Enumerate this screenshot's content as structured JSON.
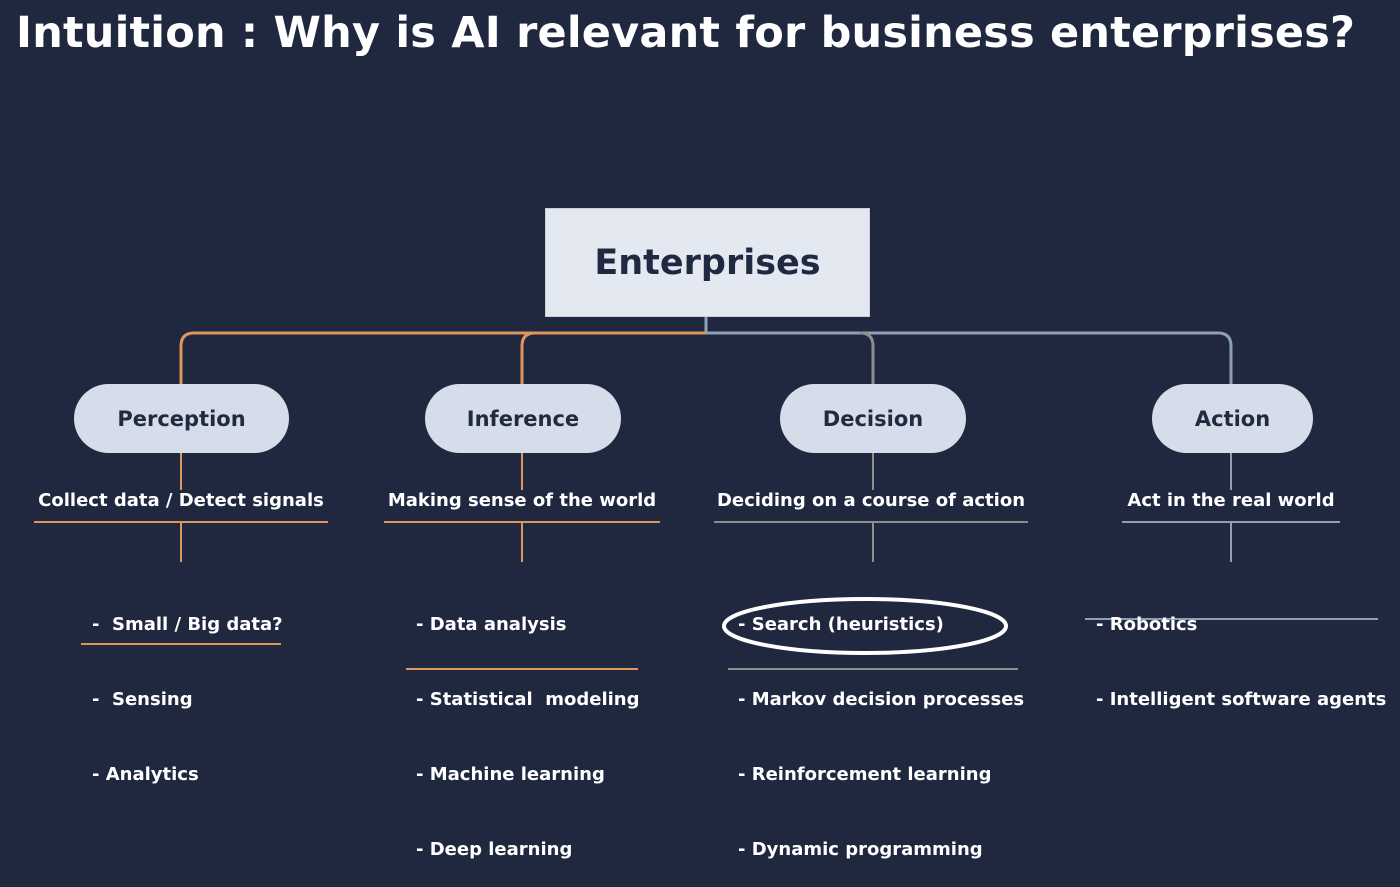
{
  "title": "Intuition : Why is AI relevant for business enterprises?",
  "root": {
    "label": "Enterprises"
  },
  "colors": {
    "background": "#202840",
    "orange": "#e0955a",
    "gray": "#8b8f87",
    "steel": "#8ea0b8",
    "pill": "#d5dcea",
    "root_box": "#e4e9f1",
    "highlight": "#ffffff"
  },
  "branches": [
    {
      "label": "Perception",
      "subtitle": "Collect data /  Detect signals",
      "items": [
        "-  Small / Big data?",
        "-  Sensing",
        "- Analytics"
      ]
    },
    {
      "label": "Inference",
      "subtitle": "Making sense of the world",
      "items": [
        "- Data analysis",
        "- Statistical  modeling",
        "- Machine learning",
        "- Deep learning"
      ]
    },
    {
      "label": "Decision",
      "subtitle": "Deciding on a course of action",
      "items": [
        "- Search (heuristics)",
        "- Markov decision processes",
        "- Reinforcement learning",
        "- Dynamic programming"
      ],
      "highlighted_item": "- Reinforcement learning"
    },
    {
      "label": "Action",
      "subtitle": "Act in the real world",
      "items": [
        "- Robotics",
        "- Intelligent software agents"
      ]
    }
  ]
}
